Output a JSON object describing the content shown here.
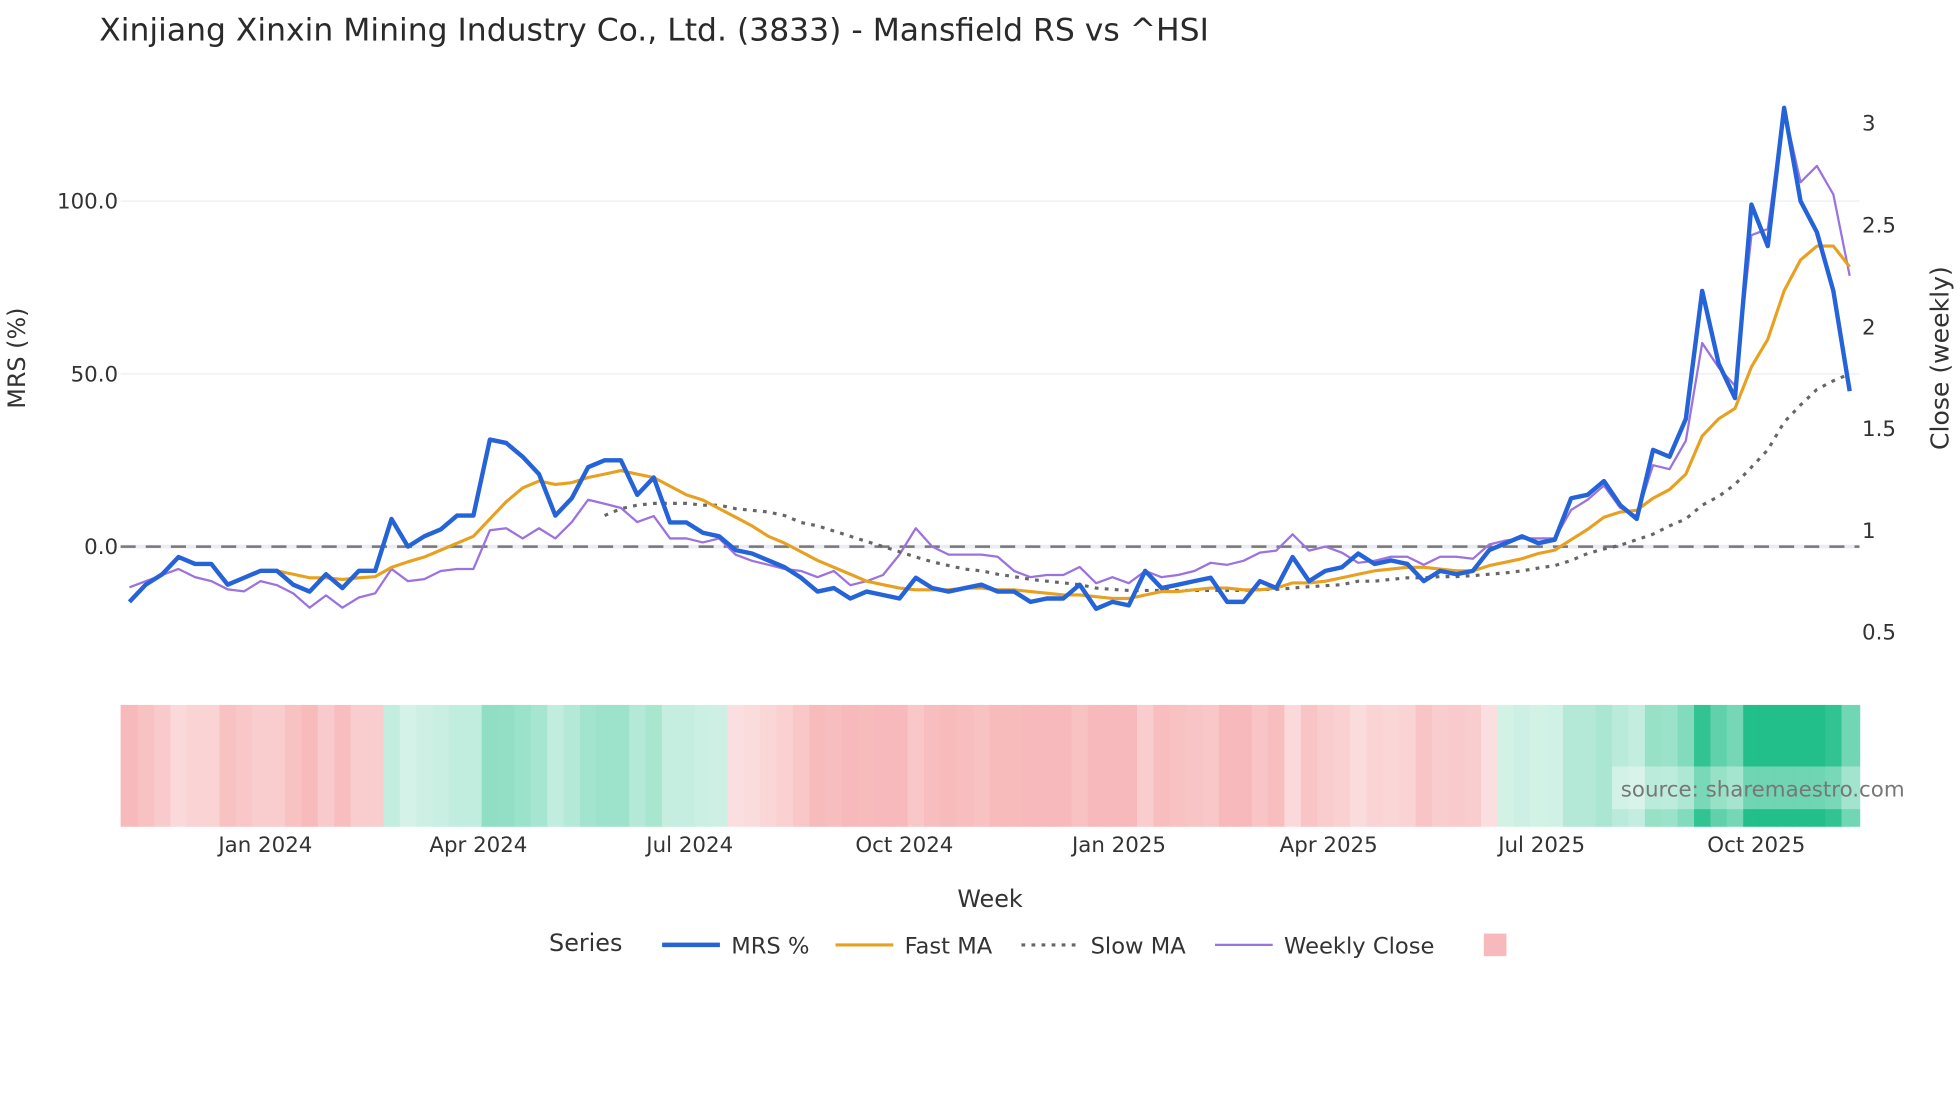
{
  "chart_data": {
    "type": "line",
    "title": "Xinjiang Xinxin Mining Industry Co., Ltd. (3833) - Mansfield RS vs ^HSI",
    "xlabel": "Week",
    "ylabel": "MRS (%)",
    "y2label": "Close (weekly)",
    "ylim": [
      -30,
      135
    ],
    "y2lim": [
      0.4,
      3.1
    ],
    "yticks": [
      "0.0",
      "50.0",
      "100.0"
    ],
    "ytick_values": [
      0,
      50,
      100
    ],
    "y2ticks": [
      "0.5",
      "1",
      "1.5",
      "2",
      "2.5",
      "3"
    ],
    "y2tick_values": [
      0.5,
      1,
      1.5,
      2,
      2.5,
      3
    ],
    "xticks": [
      "Jan 2024",
      "Apr 2024",
      "Jul 2024",
      "Oct 2024",
      "Jan 2025",
      "Apr 2025",
      "Jul 2025",
      "Oct 2025"
    ],
    "xtick_week_index": [
      8.3,
      21.3,
      34.2,
      47.3,
      60.4,
      73.2,
      86.2,
      99.3
    ],
    "week_count": 106,
    "zero_line": 0,
    "grid": true,
    "legend": {
      "title": "Series",
      "placement": "bottom-center",
      "entries": [
        "MRS %",
        "Fast MA",
        "Slow MA",
        "Weekly Close",
        ""
      ]
    },
    "annotation": "source: sharemaestro.com",
    "series": [
      {
        "name": "MRS %",
        "axis": "left",
        "color": "#2563d9",
        "start": 0,
        "values": [
          -16,
          -11,
          -8,
          -3,
          -5,
          -5,
          -11,
          -9,
          -7,
          -7,
          -11,
          -13,
          -8,
          -12,
          -7,
          -7,
          8,
          0,
          3,
          5,
          9,
          9,
          31,
          30,
          26,
          21,
          9,
          14,
          23,
          25,
          25,
          15,
          20,
          7,
          7,
          4,
          3,
          -1,
          -2,
          -4,
          -6,
          -9,
          -13,
          -12,
          -15,
          -13,
          -14,
          -15,
          -9,
          -12,
          -13,
          -12,
          -11,
          -13,
          -13,
          -16,
          -15,
          -15,
          -11,
          -18,
          -16,
          -17,
          -7,
          -12,
          -11,
          -10,
          -9,
          -16,
          -16,
          -10,
          -12,
          -3,
          -10,
          -7,
          -6,
          -2,
          -5,
          -4,
          -5,
          -10,
          -7,
          -8,
          -7,
          -1,
          1,
          3,
          1,
          2,
          14,
          15,
          19,
          12,
          8,
          28,
          26,
          37,
          74,
          53,
          43,
          99,
          87,
          127,
          100,
          91,
          74,
          45
        ]
      },
      {
        "name": "Fast MA",
        "axis": "left",
        "color": "#e8a020",
        "start": 9,
        "values": [
          -7,
          -8,
          -9,
          -9,
          -9.5,
          -9,
          -8.7,
          -6,
          -4.4,
          -3,
          -1,
          1,
          3,
          8,
          13,
          17,
          19,
          18,
          18.5,
          20,
          21,
          22,
          21,
          20,
          17.5,
          15,
          13.5,
          11,
          8.5,
          6,
          3,
          1,
          -1.5,
          -4,
          -6,
          -8,
          -10,
          -11,
          -12,
          -12.5,
          -12.5,
          -12.5,
          -12,
          -12,
          -12.5,
          -12.5,
          -13,
          -13.5,
          -14,
          -14,
          -14.5,
          -15,
          -15,
          -14,
          -13,
          -13,
          -12.5,
          -12,
          -12,
          -12.5,
          -12.5,
          -12,
          -10.5,
          -10.5,
          -10,
          -9,
          -8,
          -7,
          -6.5,
          -6,
          -6,
          -6.5,
          -7,
          -7,
          -5.5,
          -4.5,
          -3.5,
          -2,
          -1,
          2,
          5,
          8.5,
          10,
          10.5,
          14,
          16.5,
          21,
          32,
          37,
          40,
          52,
          60,
          74,
          83,
          87,
          87,
          81
        ]
      },
      {
        "name": "Slow MA",
        "axis": "left",
        "color": "#666666",
        "start": 29,
        "values": [
          9,
          11,
          12,
          12.5,
          12.5,
          12.5,
          12,
          12,
          11,
          10.5,
          10,
          9,
          7,
          6,
          4.5,
          3,
          1.5,
          0,
          -1.5,
          -3,
          -4.4,
          -5.5,
          -6.5,
          -7,
          -8,
          -8.7,
          -9.5,
          -10,
          -10.5,
          -11,
          -12,
          -12.4,
          -12.7,
          -12.7,
          -12.7,
          -12.7,
          -12.7,
          -12.7,
          -12.7,
          -12.7,
          -12.4,
          -12.4,
          -12,
          -11.6,
          -11.3,
          -11,
          -10,
          -10,
          -9.5,
          -9,
          -9,
          -8.7,
          -8.7,
          -8.4,
          -8,
          -7.6,
          -7,
          -6.2,
          -5.5,
          -4,
          -2,
          -0.7,
          0.4,
          2,
          3.6,
          6,
          8,
          12,
          14.5,
          18,
          23,
          28,
          36,
          41,
          45.5,
          48,
          50
        ]
      },
      {
        "name": "Weekly Close",
        "axis": "right",
        "color": "#9b72e0",
        "start": 0,
        "values": [
          0.72,
          0.75,
          0.78,
          0.81,
          0.77,
          0.75,
          0.71,
          0.7,
          0.75,
          0.73,
          0.69,
          0.62,
          0.68,
          0.62,
          0.67,
          0.69,
          0.81,
          0.75,
          0.76,
          0.8,
          0.81,
          0.81,
          1.0,
          1.01,
          0.96,
          1.01,
          0.96,
          1.04,
          1.15,
          1.13,
          1.11,
          1.04,
          1.07,
          0.96,
          0.96,
          0.94,
          0.96,
          0.88,
          0.85,
          0.83,
          0.81,
          0.8,
          0.77,
          0.8,
          0.73,
          0.75,
          0.78,
          0.88,
          1.01,
          0.92,
          0.88,
          0.88,
          0.88,
          0.87,
          0.8,
          0.77,
          0.78,
          0.78,
          0.82,
          0.74,
          0.77,
          0.74,
          0.8,
          0.77,
          0.78,
          0.8,
          0.84,
          0.83,
          0.85,
          0.89,
          0.9,
          0.98,
          0.9,
          0.92,
          0.89,
          0.84,
          0.85,
          0.87,
          0.87,
          0.83,
          0.87,
          0.87,
          0.86,
          0.93,
          0.95,
          0.96,
          0.96,
          0.96,
          1.1,
          1.15,
          1.22,
          1.11,
          1.07,
          1.32,
          1.3,
          1.44,
          1.92,
          1.8,
          1.71,
          2.45,
          2.48,
          3.07,
          2.71,
          2.79,
          2.65,
          2.25
        ]
      }
    ],
    "heatmap": {
      "name": "MRS regime",
      "negative_color": "#f7b9bb",
      "positive_color": "#22bf8a"
    }
  }
}
